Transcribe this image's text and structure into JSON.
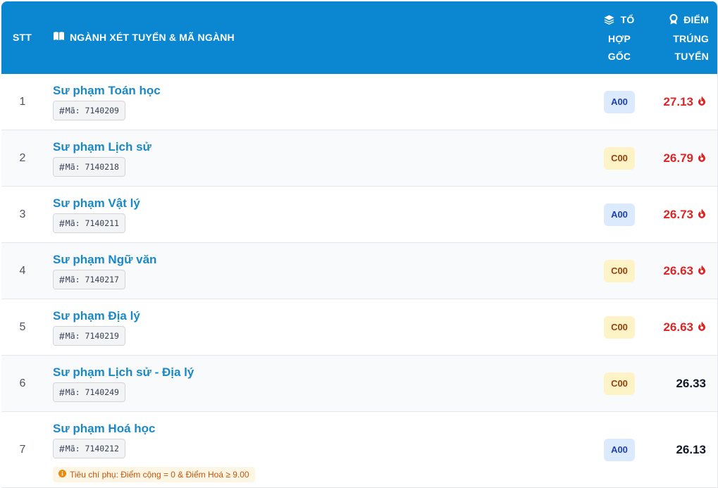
{
  "header": {
    "stt": "STT",
    "name": "NGÀNH XÉT TUYỂN & MÃ NGÀNH",
    "combo_lines": [
      "TỔ",
      "HỢP",
      "GỐC"
    ],
    "score_lines": [
      "ĐIỂM",
      "TRÚNG",
      "TUYỂN"
    ],
    "icons": {
      "name": "book-icon",
      "combo": "layers-icon",
      "score": "award-icon"
    }
  },
  "code_prefix": "#",
  "code_label": "Mã:",
  "rows": [
    {
      "stt": "1",
      "name": "Sư phạm Toán học",
      "code": "7140209",
      "combo": "A00",
      "score": "27.13",
      "hot": true
    },
    {
      "stt": "2",
      "name": "Sư phạm Lịch sử",
      "code": "7140218",
      "combo": "C00",
      "score": "26.79",
      "hot": true
    },
    {
      "stt": "3",
      "name": "Sư phạm Vật lý",
      "code": "7140211",
      "combo": "A00",
      "score": "26.73",
      "hot": true
    },
    {
      "stt": "4",
      "name": "Sư phạm Ngữ văn",
      "code": "7140217",
      "combo": "C00",
      "score": "26.63",
      "hot": true
    },
    {
      "stt": "5",
      "name": "Sư phạm Địa lý",
      "code": "7140219",
      "combo": "C00",
      "score": "26.63",
      "hot": true
    },
    {
      "stt": "6",
      "name": "Sư phạm Lịch sử - Địa lý",
      "code": "7140249",
      "combo": "C00",
      "score": "26.33",
      "hot": false
    },
    {
      "stt": "7",
      "name": "Sư phạm Hoá học",
      "code": "7140212",
      "combo": "A00",
      "score": "26.13",
      "hot": false,
      "note": "Tiêu chí phụ: Điểm cộng = 0 & Điểm Hoá ≥ 9.00"
    }
  ],
  "colors": {
    "header_bg": "#0b87d1",
    "name_link": "#1a88c9",
    "hot_score": "#dc2626",
    "a_badge": "#dbeafe",
    "c_badge": "#fef3c7"
  }
}
